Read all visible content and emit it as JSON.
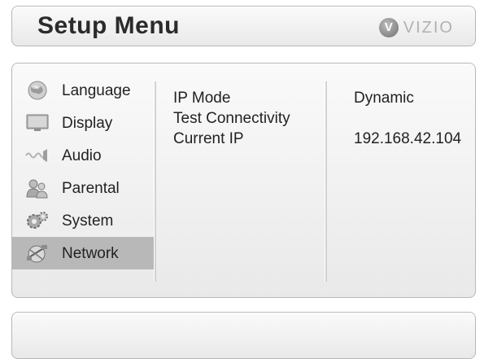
{
  "header": {
    "title": "Setup Menu",
    "logo_letter": "V",
    "logo_text": "VIZIO"
  },
  "sidebar": {
    "items": [
      {
        "label": "Language",
        "icon": "globe-icon",
        "selected": false
      },
      {
        "label": "Display",
        "icon": "monitor-icon",
        "selected": false
      },
      {
        "label": "Audio",
        "icon": "speaker-wave-icon",
        "selected": false
      },
      {
        "label": "Parental",
        "icon": "users-icon",
        "selected": false
      },
      {
        "label": "System",
        "icon": "gears-icon",
        "selected": false
      },
      {
        "label": "Network",
        "icon": "network-icon",
        "selected": true
      }
    ]
  },
  "network": {
    "settings": [
      {
        "label": "IP Mode",
        "value": "Dynamic"
      },
      {
        "label": "Test Connectivity",
        "value": ""
      },
      {
        "label": "Current IP",
        "value": "192.168.42.104"
      }
    ]
  },
  "colors": {
    "panel": "#f2f2f2",
    "selected": "#b8b8b8",
    "text": "#222222"
  }
}
